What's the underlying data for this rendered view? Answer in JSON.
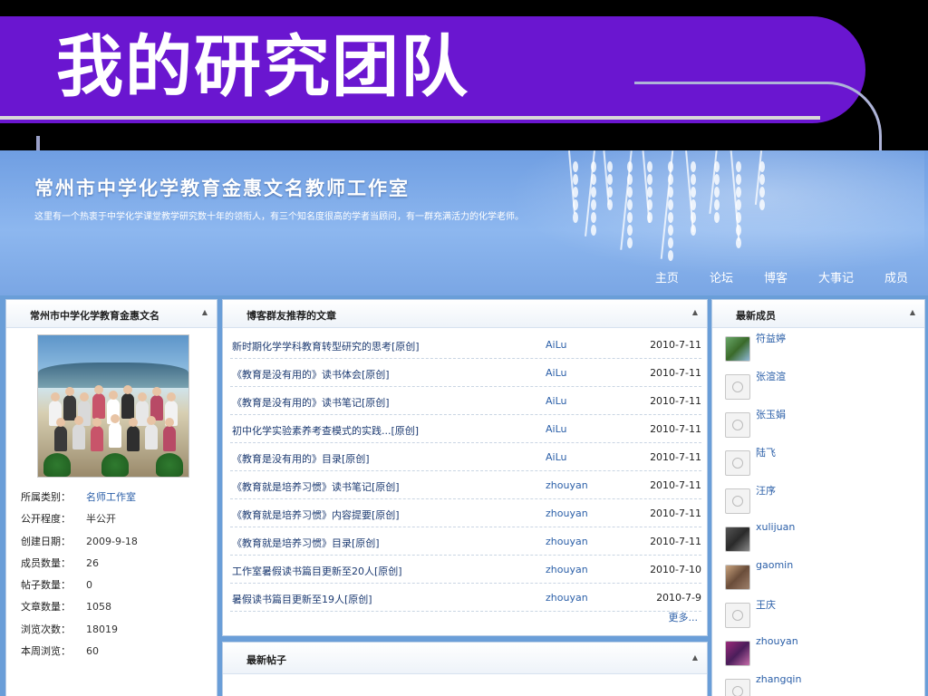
{
  "slide": {
    "title": "我的研究团队"
  },
  "site": {
    "title": "常州市中学化学教育金惠文名教师工作室",
    "subtitle": "这里有一个热衷于中学化学课堂教学研究数十年的领衔人，有三个知名度很高的学者当顾问，有一群充满活力的化学老师。",
    "nav": [
      "主页",
      "论坛",
      "博客",
      "大事记",
      "成员"
    ]
  },
  "left_panel": {
    "title": "常州市中学化学教育金惠文名",
    "info": [
      {
        "key": "所属类别：",
        "value": "名师工作室"
      },
      {
        "key": "公开程度：",
        "value": "半公开"
      },
      {
        "key": "创建日期：",
        "value": "2009-9-18"
      },
      {
        "key": "成员数量：",
        "value": "26"
      },
      {
        "key": "帖子数量：",
        "value": "0"
      },
      {
        "key": "文章数量：",
        "value": "1058"
      },
      {
        "key": "浏览次数：",
        "value": "18019"
      },
      {
        "key": "本周浏览：",
        "value": "60"
      }
    ]
  },
  "articles": {
    "title": "博客群友推荐的文章",
    "more": "更多...",
    "rows": [
      {
        "title": "新时期化学学科教育转型研究的思考[原创]",
        "author": "AiLu",
        "date": "2010-7-11"
      },
      {
        "title": "《教育是没有用的》读书体会[原创]",
        "author": "AiLu",
        "date": "2010-7-11"
      },
      {
        "title": "《教育是没有用的》读书笔记[原创]",
        "author": "AiLu",
        "date": "2010-7-11"
      },
      {
        "title": "初中化学实验素养考查模式的实践...[原创]",
        "author": "AiLu",
        "date": "2010-7-11"
      },
      {
        "title": "《教育是没有用的》目录[原创]",
        "author": "AiLu",
        "date": "2010-7-11"
      },
      {
        "title": "《教育就是培养习惯》读书笔记[原创]",
        "author": "zhouyan",
        "date": "2010-7-11"
      },
      {
        "title": "《教育就是培养习惯》内容提要[原创]",
        "author": "zhouyan",
        "date": "2010-7-11"
      },
      {
        "title": "《教育就是培养习惯》目录[原创]",
        "author": "zhouyan",
        "date": "2010-7-11"
      },
      {
        "title": "工作室暑假读书篇目更新至20人[原创]",
        "author": "zhouyan",
        "date": "2010-7-10"
      },
      {
        "title": "暑假读书篇目更新至19人[原创]",
        "author": "zhouyan",
        "date": "2010-7-9"
      }
    ]
  },
  "posts": {
    "title": "最新帖子"
  },
  "members": {
    "title": "最新成员",
    "list": [
      {
        "name": "符益婷",
        "avatar": "photo1"
      },
      {
        "name": "张渲渲",
        "avatar": "face"
      },
      {
        "name": "张玉娟",
        "avatar": "face"
      },
      {
        "name": "陆飞",
        "avatar": "face"
      },
      {
        "name": "汪序",
        "avatar": "face"
      },
      {
        "name": "xulijuan",
        "avatar": "photo2"
      },
      {
        "name": "gaomin",
        "avatar": "photo3"
      },
      {
        "name": "王庆",
        "avatar": "face"
      },
      {
        "name": "zhouyan",
        "avatar": "photo4"
      },
      {
        "name": "zhangqin",
        "avatar": "face"
      }
    ]
  },
  "colors": {
    "slide_bar": "#6a16d0",
    "banner": "#7aa6e4",
    "link": "#2b5fa8"
  }
}
